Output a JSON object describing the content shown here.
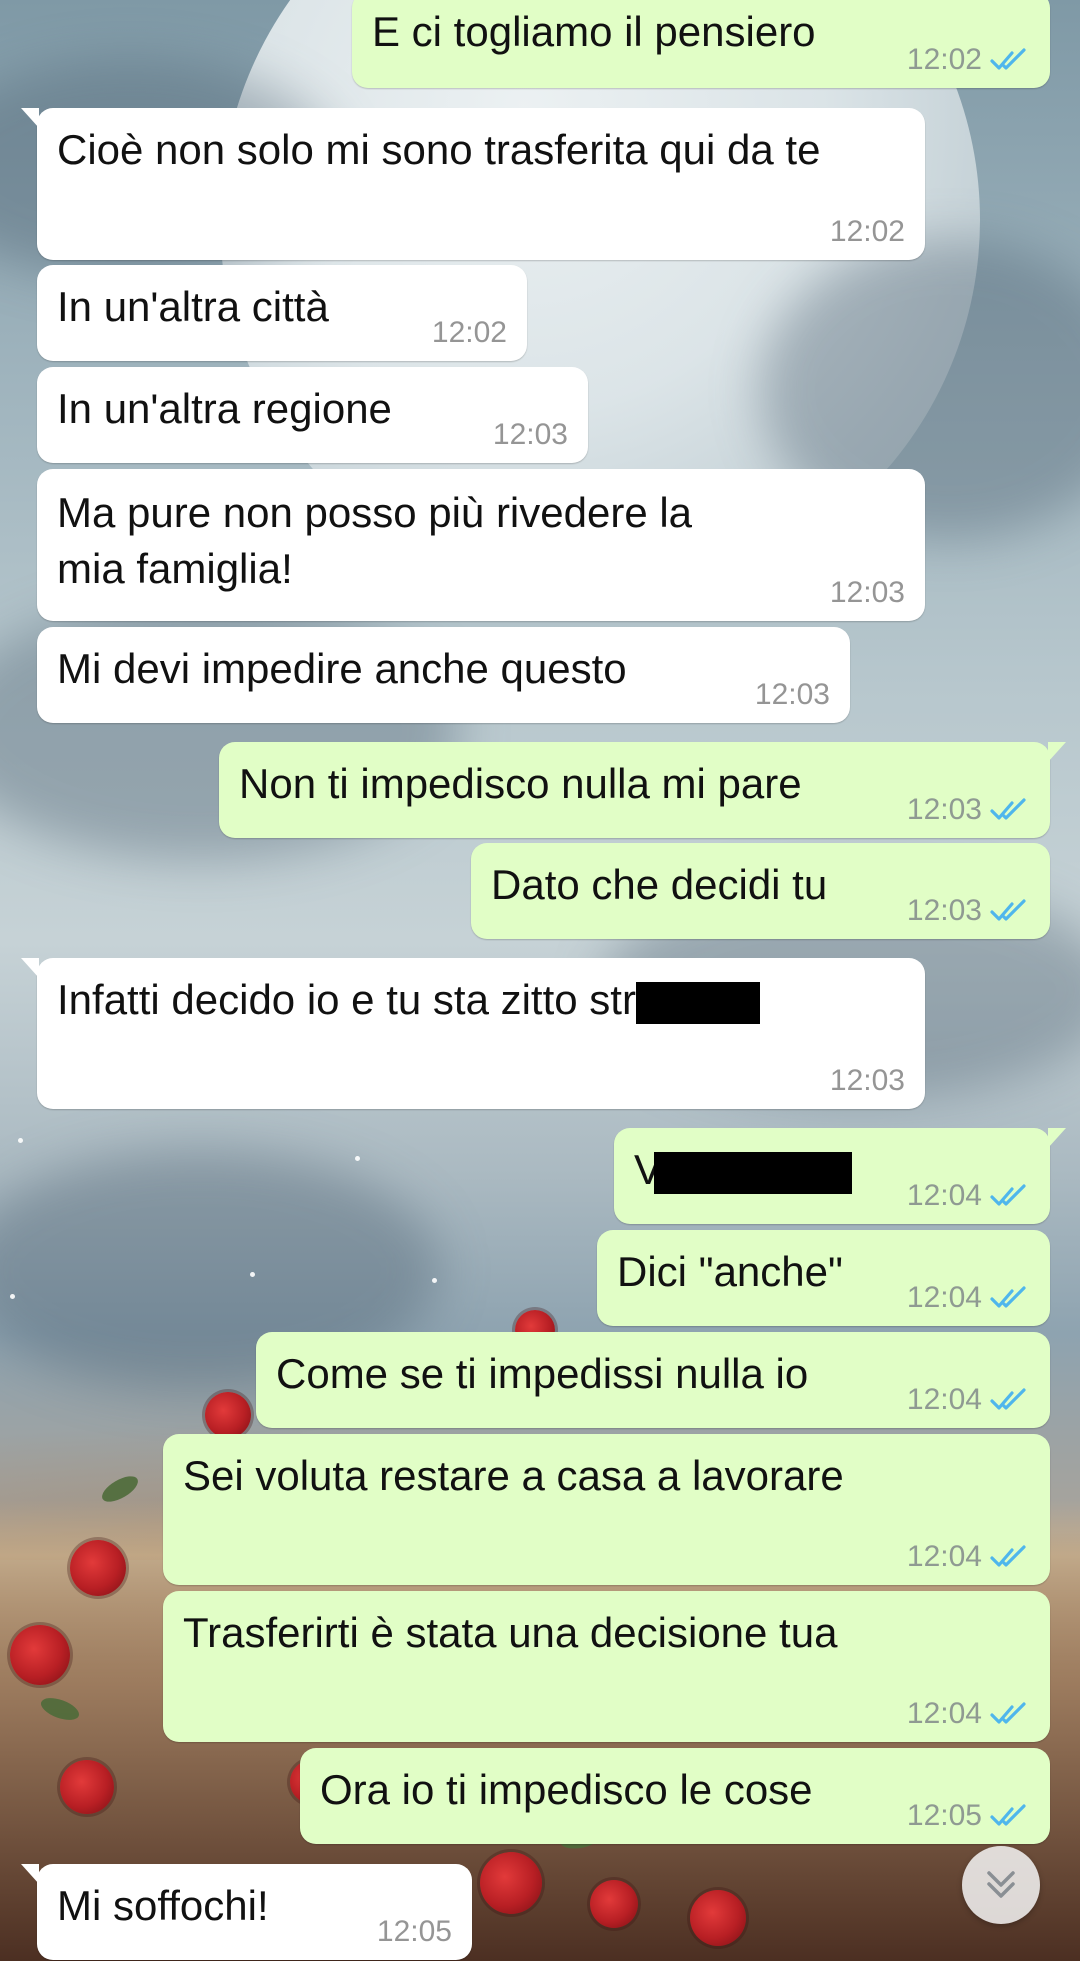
{
  "messages": [
    {
      "id": "m1",
      "dir": "out",
      "text": "E ci togliamo il pensiero",
      "time": "12:02",
      "status": "read"
    },
    {
      "id": "m2",
      "dir": "in",
      "text": "Cioè non solo mi sono trasferita qui da te",
      "time": "12:02"
    },
    {
      "id": "m3",
      "dir": "in",
      "text": "In un'altra città",
      "time": "12:02"
    },
    {
      "id": "m4",
      "dir": "in",
      "text": "In un'altra regione",
      "time": "12:03"
    },
    {
      "id": "m5",
      "dir": "in",
      "text": "Ma pure non posso più rivedere la mia famiglia!",
      "time": "12:03"
    },
    {
      "id": "m6",
      "dir": "in",
      "text": "Mi devi impedire anche questo",
      "time": "12:03"
    },
    {
      "id": "m7",
      "dir": "out",
      "text": "Non ti impedisco nulla mi pare",
      "time": "12:03",
      "status": "read"
    },
    {
      "id": "m8",
      "dir": "out",
      "text": "Dato che decidi tu",
      "time": "12:03",
      "status": "read"
    },
    {
      "id": "m9",
      "dir": "in",
      "text": "Infatti decido io e tu sta zitto str",
      "time": "12:03",
      "redacted": true
    },
    {
      "id": "m10",
      "dir": "out",
      "text": "V",
      "time": "12:04",
      "status": "read",
      "redacted": true
    },
    {
      "id": "m11",
      "dir": "out",
      "text": "Dici \"anche\"",
      "time": "12:04",
      "status": "read"
    },
    {
      "id": "m12",
      "dir": "out",
      "text": "Come se ti impedissi nulla io",
      "time": "12:04",
      "status": "read"
    },
    {
      "id": "m13",
      "dir": "out",
      "text": "Sei voluta restare a casa a lavorare",
      "time": "12:04",
      "status": "read"
    },
    {
      "id": "m14",
      "dir": "out",
      "text": "Trasferirti è stata una decisione tua",
      "time": "12:04",
      "status": "read"
    },
    {
      "id": "m15",
      "dir": "out",
      "text": "Ora io ti impedisco le cose",
      "time": "12:05",
      "status": "read"
    },
    {
      "id": "m16",
      "dir": "in",
      "text": "Mi soffochi!",
      "time": "12:05"
    }
  ],
  "icons": {
    "read_receipt": "double-check-icon",
    "scroll_down": "chevron-double-down-icon"
  },
  "colors": {
    "incoming_bubble": "#ffffff",
    "outgoing_bubble": "#e1fec6",
    "read_tick": "#4fb6ec",
    "timestamp": "#959595"
  }
}
